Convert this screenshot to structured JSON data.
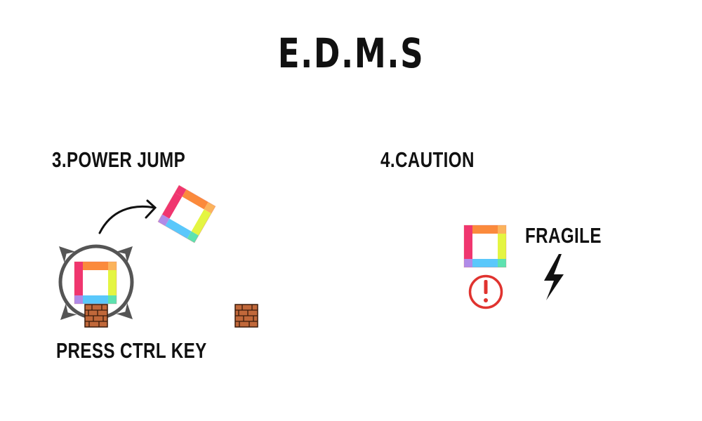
{
  "title": "E.D.M.S",
  "sections": {
    "power_jump": {
      "heading": "3.POWER JUMP",
      "instruction": "PRESS CTRL KEY"
    },
    "caution": {
      "heading": "4.CAUTION",
      "label": "FRAGILE"
    }
  },
  "colors": {
    "pink": "#f0366f",
    "orange": "#fb8a3c",
    "yellow_green": "#e4f542",
    "light_blue": "#5ac8fb",
    "purple": "#b08be8",
    "mint": "#5ee2b0",
    "peach": "#fbb35c",
    "brick": "#c1683a",
    "warning_red": "#e0332f",
    "ink": "#222222"
  },
  "icons": [
    "rainbow-block-icon",
    "brick-tile-icon",
    "expand-arrows-icon",
    "curved-arrow-icon",
    "warning-circle-icon",
    "lightning-bolt-icon"
  ]
}
